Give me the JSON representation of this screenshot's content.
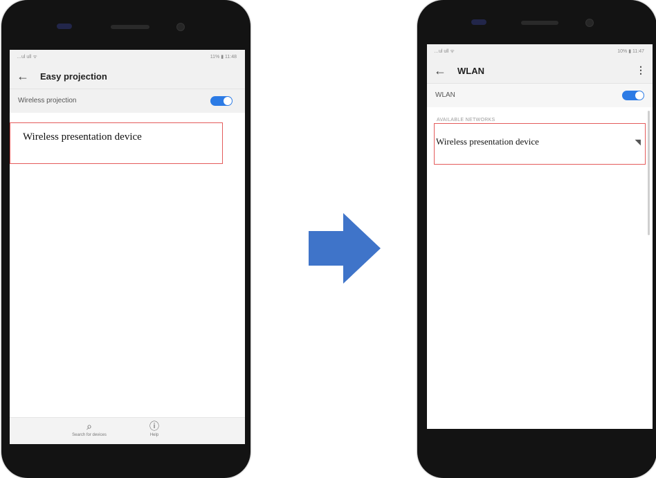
{
  "left_phone": {
    "status_left": "…ul ull ᯤ",
    "status_right": "11% ▮ 11:48",
    "title": "Easy projection",
    "setting_label": "Wireless projection",
    "device_name": "Wireless presentation device",
    "bottom_items": [
      {
        "icon": "search-icon",
        "label": "Search for devices"
      },
      {
        "icon": "info-icon",
        "label": "Help"
      }
    ]
  },
  "right_phone": {
    "status_left": "…ul ull ᯤ",
    "status_right": "10% ▮ 11:47",
    "title": "WLAN",
    "setting_label": "WLAN",
    "section_header": "AVAILABLE NETWORKS",
    "network_name": "Wireless presentation device"
  },
  "colors": {
    "toggle_on": "#2c7be5",
    "highlight_border": "#e45a5a",
    "arrow": "#3f74c9"
  }
}
